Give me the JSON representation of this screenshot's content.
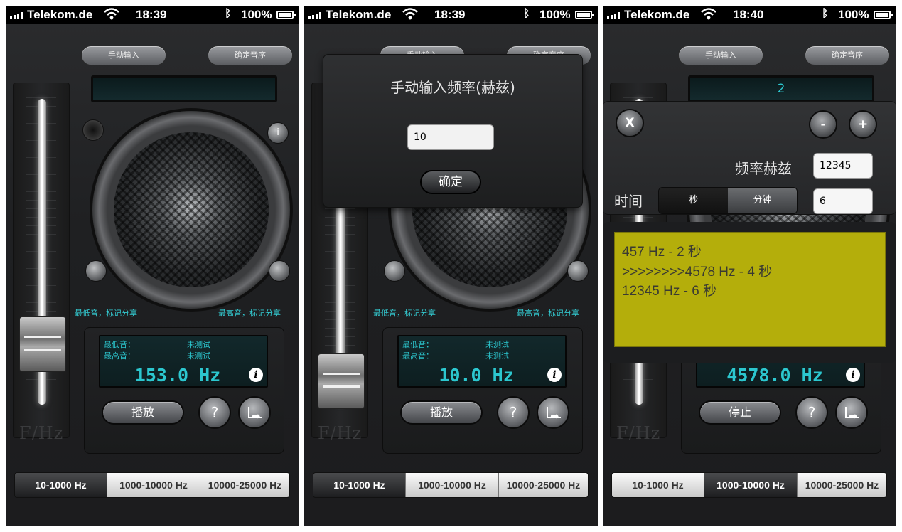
{
  "status": {
    "carrier": "Telekom.de",
    "battery": "100%"
  },
  "screens": [
    {
      "time": "18:39",
      "top_display": "",
      "freq": "153.0 Hz",
      "lcd_min_label": "最低音：",
      "lcd_min_value": "未测试",
      "lcd_max_label": "最高音：",
      "lcd_max_value": "未测试",
      "play_label": "播放",
      "range_selected": 0
    },
    {
      "time": "18:39",
      "top_display": "",
      "freq": "10.0 Hz",
      "lcd_min_label": "最低音：",
      "lcd_min_value": "未测试",
      "lcd_max_label": "最高音：",
      "lcd_max_value": "未测试",
      "play_label": "播放",
      "range_selected": 0,
      "modal": {
        "title": "手动输入频率(赫兹)",
        "input_value": "10",
        "ok_label": "确定"
      }
    },
    {
      "time": "18:40",
      "top_display": "2",
      "freq": "4578.0 Hz",
      "play_label": "停止",
      "range_selected": 1,
      "overlay": {
        "close_label": "X",
        "minus_label": "-",
        "plus_label": "+",
        "freq_label": "频率赫兹",
        "freq_value": "12345",
        "time_label": "时间",
        "unit_sec": "秒",
        "unit_min": "分钟",
        "time_value": "6",
        "sequence": [
          "457 Hz - 2 秒",
          ">>>>>>>>4578 Hz - 4 秒",
          "12345 Hz - 6 秒"
        ]
      }
    }
  ],
  "common": {
    "manual_input": "手动输入",
    "confirm_pitch": "确定音序",
    "min_caption": "最低音，标记分享",
    "max_caption": "最高音，标记分享",
    "slider_label": "F/Hz",
    "help_symbol": "?",
    "info_symbol": "i",
    "ranges": [
      "10-1000 Hz",
      "1000-10000 Hz",
      "10000-25000 Hz"
    ]
  },
  "colors": {
    "lcd_text": "#2cc7cf",
    "sequence_bg": "#b4ae0b"
  },
  "icons": [
    "signal-icon",
    "wifi-icon",
    "bluetooth-icon",
    "battery-icon",
    "info-icon",
    "help-icon",
    "share-icon"
  ]
}
